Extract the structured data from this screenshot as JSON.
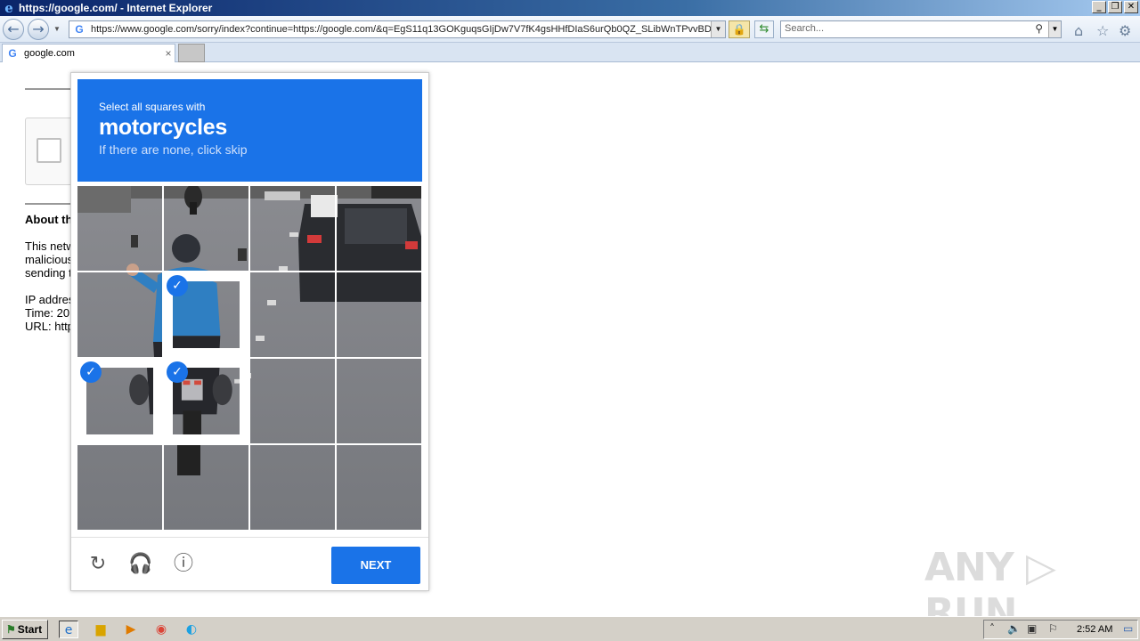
{
  "window": {
    "title": "https://google.com/ - Internet Explorer",
    "minimize": "_",
    "restore": "❐",
    "close": "✕"
  },
  "nav": {
    "back_icon": "back-arrow-icon",
    "forward_icon": "forward-arrow-icon",
    "url": "https://www.google.com/sorry/index?continue=https://google.com/&q=EgS11q13GOKguqsGIjDw7V7fK4gsHHfDIaS6urQb0QZ_SLibWnTPvvBDwt",
    "search_placeholder": "Search..."
  },
  "tabs": [
    {
      "label": "google.com",
      "close": "×"
    }
  ],
  "page": {
    "about_heading": "About th",
    "lines": [
      "This netw",
      "malicious",
      "sending t",
      "",
      "IP addres",
      "Time: 20",
      "URL: http"
    ]
  },
  "captcha": {
    "line1": "Select all squares with",
    "target": "motorcycles",
    "line3": "If there are none, click skip",
    "selected_tiles": [
      5,
      8,
      9
    ],
    "footer_icons": [
      "reload-icon",
      "headphones-icon",
      "info-icon"
    ],
    "next_label": "NEXT"
  },
  "watermark": "ANY ▷ RUN",
  "taskbar": {
    "start_label": "Start",
    "clock": "2:52 AM"
  }
}
